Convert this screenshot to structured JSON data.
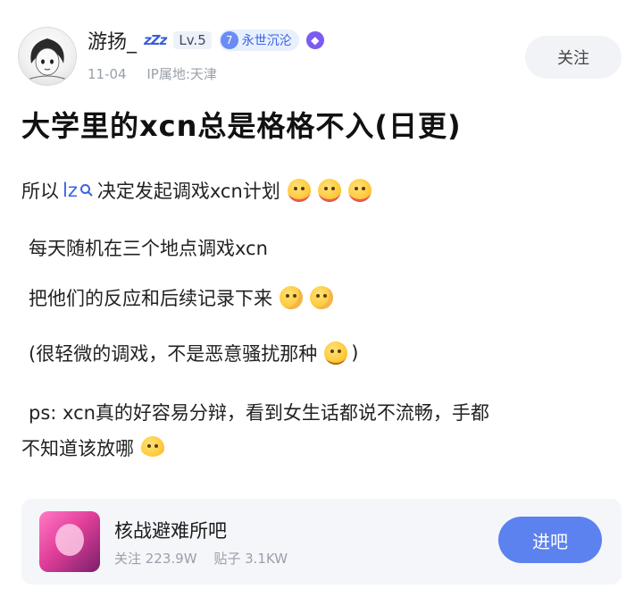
{
  "author": {
    "name": "游扬_",
    "sleep_badge": "zZz",
    "level": "Lv.5",
    "title_badge_number": "7",
    "title_badge_text": "永世沉沦",
    "medal_icon": "medal-icon",
    "date": "11-04",
    "ip_location": "IP属地:天津"
  },
  "follow_label": "关注",
  "post": {
    "title": "大学里的xcn总是格格不入(日更)",
    "lines": [
      {
        "before": "所以",
        "lz": "lz",
        "after": "决定发起调戏xcn计划"
      },
      {
        "text": "每天随机在三个地点调戏xcn"
      },
      {
        "text": "把他们的反应和后续记录下来"
      },
      {
        "text": "(很轻微的调戏，不是恶意骚扰那种",
        "tail": ")"
      },
      {
        "text": "ps: xcn真的好容易分辩，看到女生话都说不流畅，手都"
      },
      {
        "text": "不知道该放哪"
      }
    ]
  },
  "forum": {
    "name": "核战避难所吧",
    "followers": "关注 223.9W",
    "posts": "贴子 3.1KW",
    "enter_label": "进吧"
  },
  "colors": {
    "accent": "#5b82ef",
    "link": "#3b63e6",
    "meta": "#9aa0aa"
  }
}
